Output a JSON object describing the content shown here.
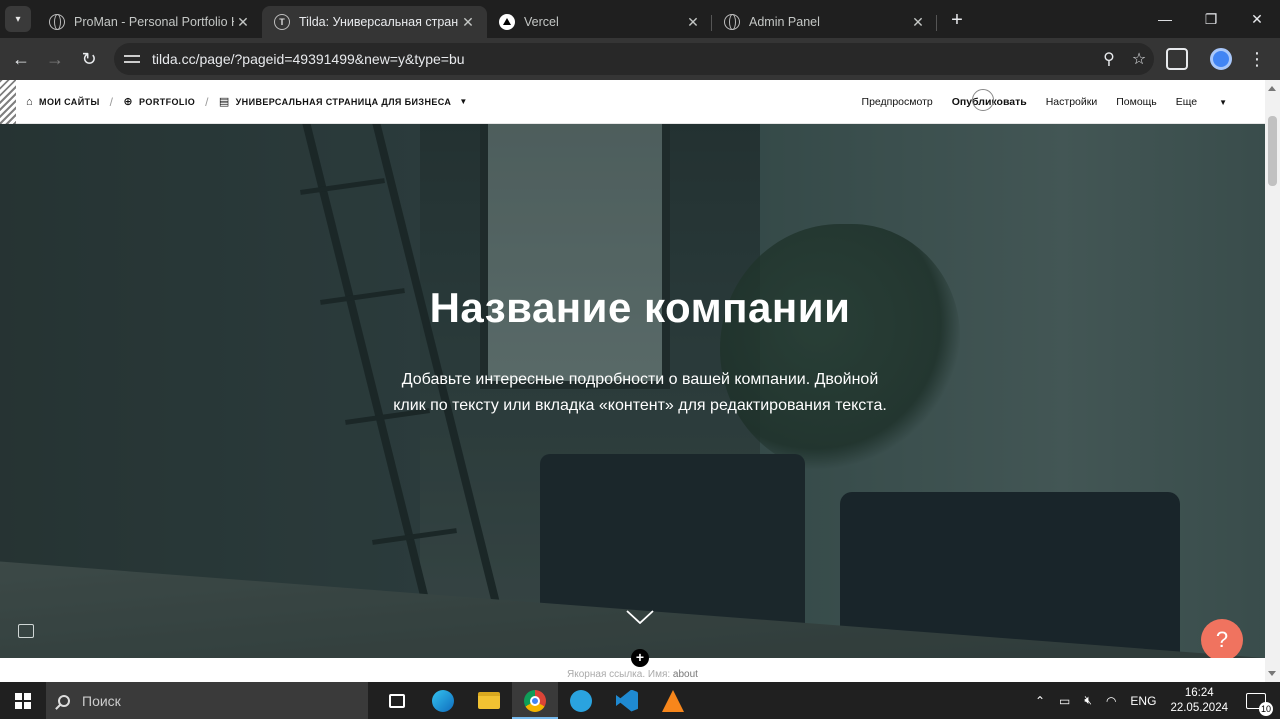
{
  "browser": {
    "tabs": [
      {
        "title": "ProMan - Personal Portfolio HTML",
        "icon": "globe-icon",
        "active": false
      },
      {
        "title": "Tilda: Универсальная страница",
        "icon": "tilda-icon",
        "active": true
      },
      {
        "title": "Vercel",
        "icon": "vercel-icon",
        "active": false
      },
      {
        "title": "Admin Panel",
        "icon": "globe-icon",
        "active": false
      }
    ],
    "url": "tilda.cc/page/?pageid=49391499&new=y&type=bu"
  },
  "tilda_bar": {
    "breadcrumbs": [
      "МОИ САЙТЫ",
      "PORTFOLIO",
      "УНИВЕРСАЛЬНАЯ СТРАНИЦА ДЛЯ БИЗНЕСА"
    ],
    "actions": {
      "preview": "Предпросмотр",
      "publish": "Опубликовать",
      "settings": "Настройки",
      "help": "Помощь",
      "more": "Еще"
    }
  },
  "hero": {
    "title": "Название компании",
    "description": "Добавьте интересные подробности о вашей компании. Двойной клик по тексту или вкладка «контент» для редактирования текста.",
    "help_glyph": "?"
  },
  "anchor": {
    "label": "Якорная ссылка. Имя:",
    "name": "about"
  },
  "taskbar": {
    "search_placeholder": "Поиск",
    "language": "ENG",
    "time": "16:24",
    "date": "22.05.2024",
    "notification_count": "10"
  },
  "colors": {
    "help_button": "#f0735f",
    "taskbar": "#202020",
    "browser_frame": "#1f1f1f"
  }
}
